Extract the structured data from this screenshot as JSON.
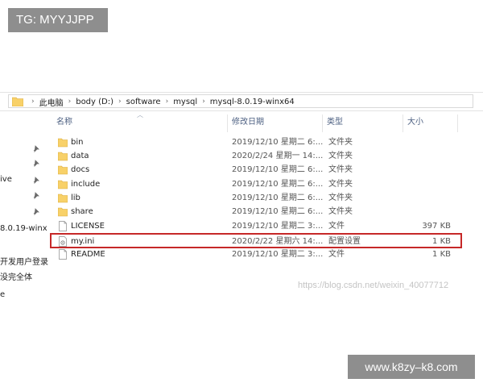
{
  "overlays": {
    "tg_label": "TG: MYYJJPP",
    "site_label": "www.k8zy–k8.com",
    "watermark": "https://blog.csdn.net/weixin_40077712"
  },
  "breadcrumb": [
    "此电脑",
    "body (D:)",
    "software",
    "mysql",
    "mysql-8.0.19-winx64"
  ],
  "nav": {
    "items": [
      "ive",
      "8.0.19-winx",
      "开发用户登录",
      "没完全体",
      "e"
    ]
  },
  "columns": {
    "name": "名称",
    "date": "修改日期",
    "type": "类型",
    "size": "大小"
  },
  "files": [
    {
      "name": "bin",
      "date": "2019/12/10 星期二 6:...",
      "type": "文件夹",
      "size": "",
      "kind": "folder"
    },
    {
      "name": "data",
      "date": "2020/2/24 星期一 14:...",
      "type": "文件夹",
      "size": "",
      "kind": "folder"
    },
    {
      "name": "docs",
      "date": "2019/12/10 星期二 6:...",
      "type": "文件夹",
      "size": "",
      "kind": "folder"
    },
    {
      "name": "include",
      "date": "2019/12/10 星期二 6:...",
      "type": "文件夹",
      "size": "",
      "kind": "folder"
    },
    {
      "name": "lib",
      "date": "2019/12/10 星期二 6:...",
      "type": "文件夹",
      "size": "",
      "kind": "folder"
    },
    {
      "name": "share",
      "date": "2019/12/10 星期二 6:...",
      "type": "文件夹",
      "size": "",
      "kind": "folder"
    },
    {
      "name": "LICENSE",
      "date": "2019/12/10 星期二 3:...",
      "type": "文件",
      "size": "397 KB",
      "kind": "file"
    },
    {
      "name": "my.ini",
      "date": "2020/2/22 星期六 14:...",
      "type": "配置设置",
      "size": "1 KB",
      "kind": "config"
    },
    {
      "name": "README",
      "date": "2019/12/10 星期二 3:...",
      "type": "文件",
      "size": "1 KB",
      "kind": "file"
    }
  ],
  "colors": {
    "folder": "#f8d169",
    "highlight_border": "#c62828",
    "header_text": "#4d6082"
  }
}
